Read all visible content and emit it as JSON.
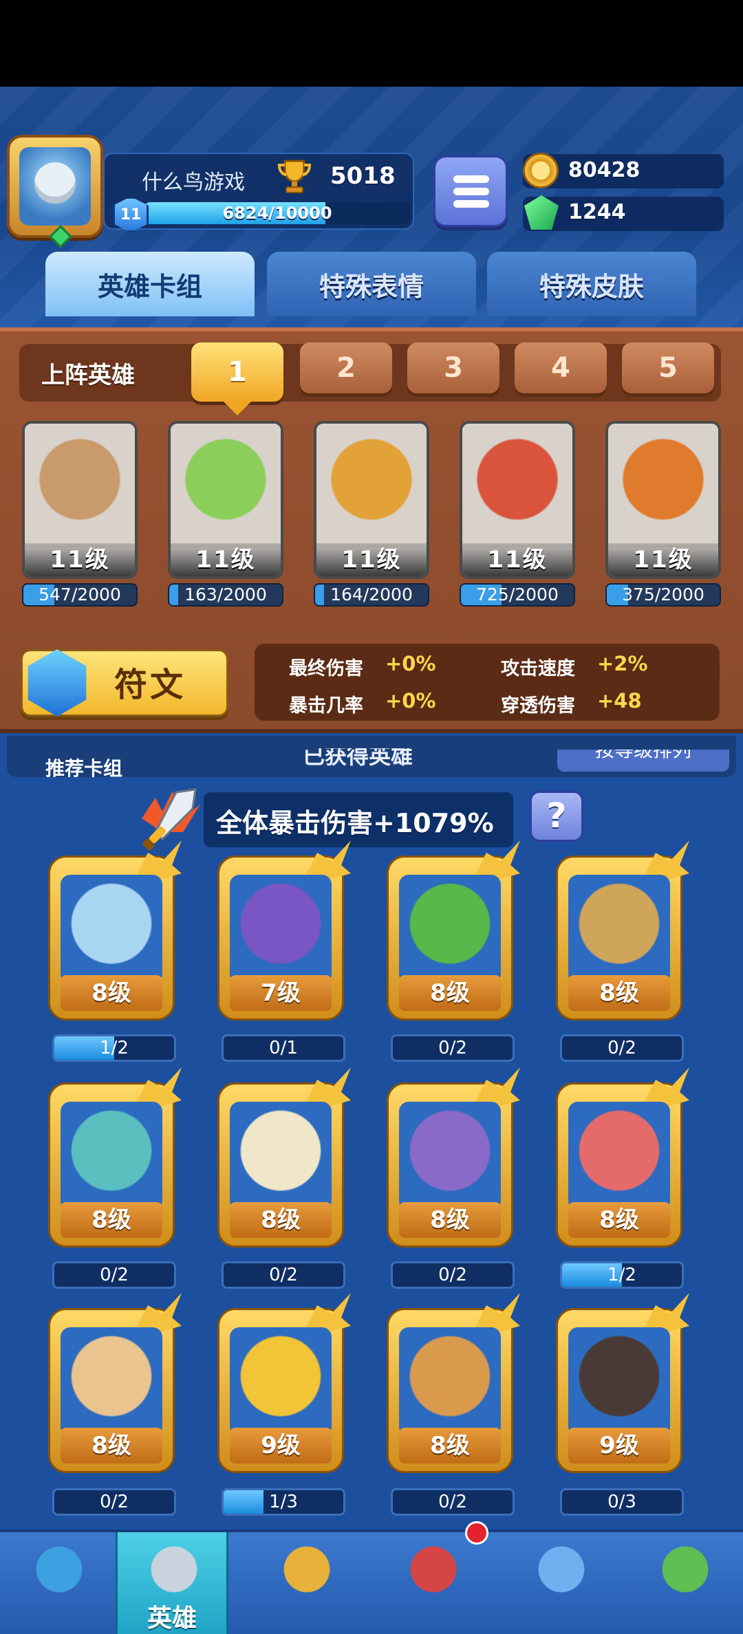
{
  "profile": {
    "player_name": "什么鸟游戏",
    "trophies": "5018",
    "level": "11",
    "xp_text": "6824/10000",
    "xp_fraction": 0.6824
  },
  "currency": {
    "coins": "80428",
    "gems": "1244"
  },
  "tabs": [
    "英雄卡组",
    "特殊表情",
    "特殊皮肤"
  ],
  "lineup": {
    "label": "上阵英雄",
    "slots": [
      "1",
      "2",
      "3",
      "4",
      "5"
    ],
    "active_slot": 1
  },
  "deck": [
    {
      "level": "11级",
      "progress": "547/2000",
      "fraction": 0.2735,
      "icon": "hero-rock-golem",
      "color": "#c99a6a"
    },
    {
      "level": "11级",
      "progress": "163/2000",
      "fraction": 0.0815,
      "icon": "hero-hooded-archer",
      "color": "#8bcf5a"
    },
    {
      "level": "11级",
      "progress": "164/2000",
      "fraction": 0.082,
      "icon": "hero-tiki-warrior",
      "color": "#e3a237"
    },
    {
      "level": "11级",
      "progress": "725/2000",
      "fraction": 0.3625,
      "icon": "hero-goggle-bomber",
      "color": "#d9543a"
    },
    {
      "level": "11级",
      "progress": "375/2000",
      "fraction": 0.1875,
      "icon": "hero-knight-gunner",
      "color": "#e07a2c"
    }
  ],
  "rune": {
    "label": "符文"
  },
  "stats": [
    {
      "label": "最终伤害",
      "value": "+0%"
    },
    {
      "label": "攻击速度",
      "value": "+2%"
    },
    {
      "label": "暴击几率",
      "value": "+0%"
    },
    {
      "label": "穿透伤害",
      "value": "+48"
    }
  ],
  "collection": {
    "recommend_label": "推荐卡组",
    "obtained_label": "已获得英雄",
    "sort_label": "按等级排列",
    "crit_text": "全体暴击伤害+1079%",
    "help_label": "?"
  },
  "owned_heroes": [
    {
      "level": "8级",
      "progress": "1/2",
      "fraction": 0.5,
      "icon": "hero-yeti",
      "color": "#a8d6f2"
    },
    {
      "level": "7级",
      "progress": "0/1",
      "fraction": 0,
      "icon": "hero-shadow-mage",
      "color": "#7a55c4"
    },
    {
      "level": "8级",
      "progress": "0/2",
      "fraction": 0,
      "icon": "hero-masked-bandit",
      "color": "#58b84a"
    },
    {
      "level": "8级",
      "progress": "0/2",
      "fraction": 0,
      "icon": "hero-wooden-totem",
      "color": "#cfa55a"
    },
    {
      "level": "8级",
      "progress": "0/2",
      "fraction": 0,
      "icon": "hero-police-officer",
      "color": "#5bbfc0"
    },
    {
      "level": "8级",
      "progress": "0/2",
      "fraction": 0,
      "icon": "hero-hooded-monk",
      "color": "#f0e6c9"
    },
    {
      "level": "8级",
      "progress": "0/2",
      "fraction": 0,
      "icon": "hero-octopus-pirate",
      "color": "#8a6ac8"
    },
    {
      "level": "8级",
      "progress": "1/2",
      "fraction": 0.5,
      "icon": "hero-monocle-gentleman",
      "color": "#e56b6b"
    },
    {
      "level": "8级",
      "progress": "0/2",
      "fraction": 0,
      "icon": "hero-bearded-sage",
      "color": "#e9c48f"
    },
    {
      "level": "9级",
      "progress": "1/3",
      "fraction": 0.3333,
      "icon": "hero-helmet-brute",
      "color": "#f2c437"
    },
    {
      "level": "8级",
      "progress": "0/2",
      "fraction": 0,
      "icon": "hero-cowboy-sheriff",
      "color": "#d99a4e"
    },
    {
      "level": "9级",
      "progress": "0/3",
      "fraction": 0,
      "icon": "hero-lava-golem",
      "color": "#4a3a36"
    }
  ],
  "nav": [
    {
      "icon": "treasure-chest-icon",
      "label": ""
    },
    {
      "icon": "knight-helmet-icon",
      "label": "英雄",
      "active": true
    },
    {
      "icon": "crossed-swords-icon",
      "label": ""
    },
    {
      "icon": "crown-shield-icon",
      "label": "",
      "badge": true
    },
    {
      "icon": "guild-banner-icon",
      "label": ""
    },
    {
      "icon": "sprout-island-icon",
      "label": ""
    }
  ]
}
